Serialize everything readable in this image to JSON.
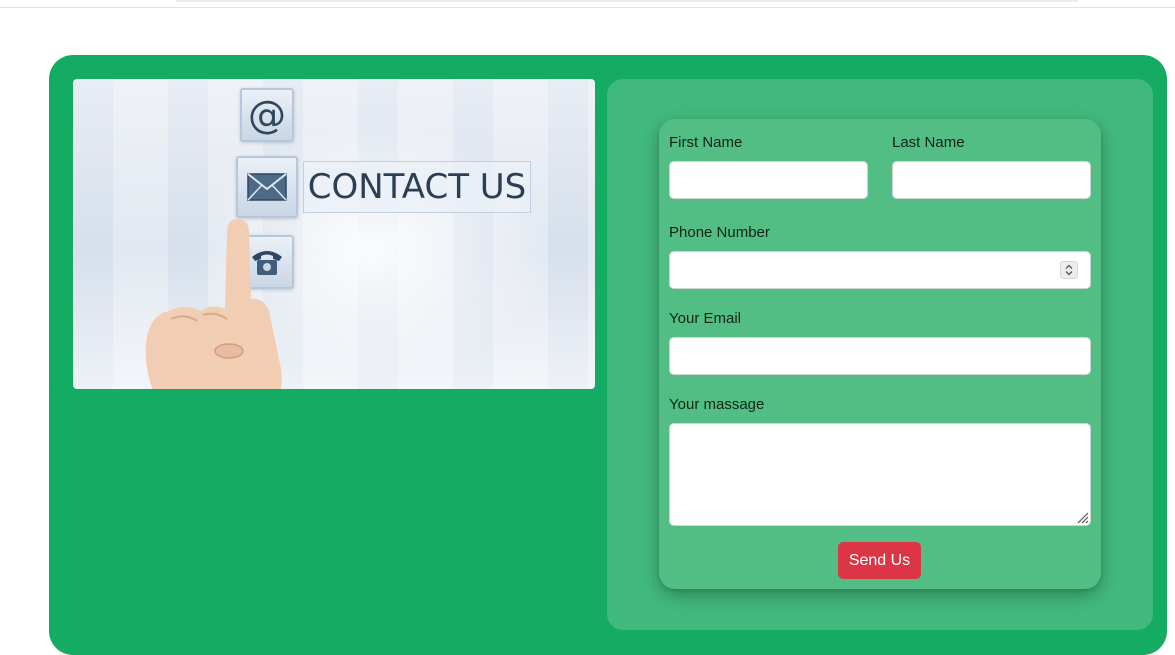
{
  "contact_image": {
    "heading": "CONTACT US",
    "at_symbol": "@",
    "icons": [
      "at-sign-icon",
      "envelope-icon",
      "telephone-icon"
    ]
  },
  "form": {
    "first_name_label": "First Name",
    "last_name_label": "Last Name",
    "phone_label": "Phone Number",
    "email_label": "Your Email",
    "message_label": "Your massage",
    "first_name_value": "",
    "last_name_value": "",
    "phone_value": "",
    "email_value": "",
    "message_value": "",
    "submit_label": "Send Us"
  },
  "colors": {
    "section_bg": "#14ab62",
    "panel_bg": "#42b97c",
    "card_bg": "#52be84",
    "submit_bg": "#dc3545"
  }
}
